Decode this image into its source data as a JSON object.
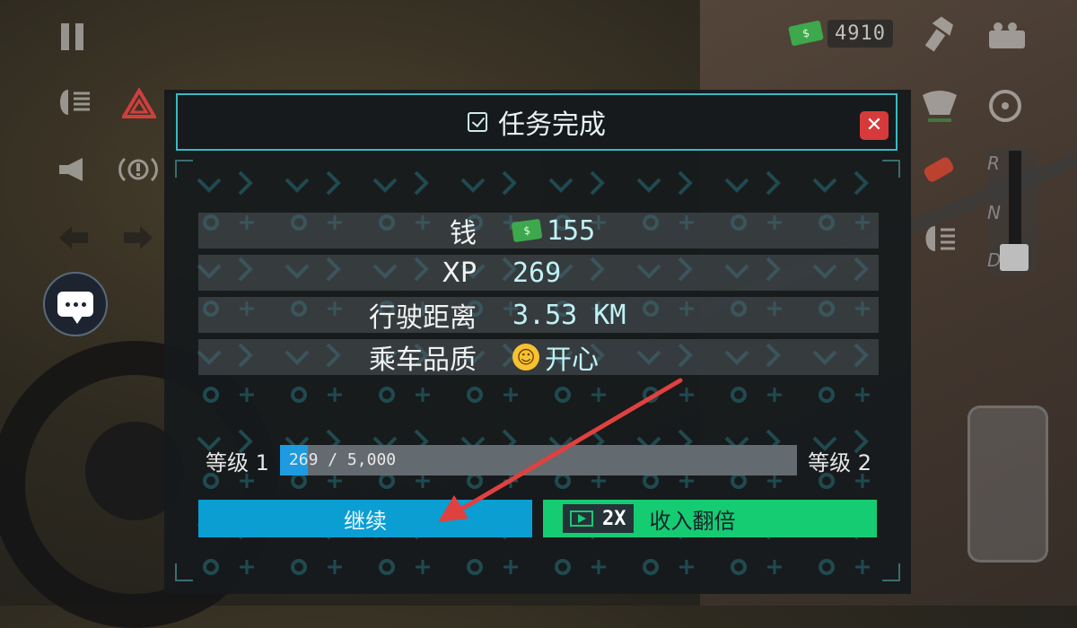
{
  "hud": {
    "money": "4910",
    "money_icon": "cash-icon",
    "pause_icon": "pause-icon"
  },
  "dialog": {
    "title": "任务完成",
    "rows": [
      {
        "label": "钱",
        "value": "155"
      },
      {
        "label": "XP",
        "value": "269"
      },
      {
        "label": "行驶距离",
        "value": "3.53 KM"
      },
      {
        "label": "乘车品质",
        "value": "开心"
      }
    ],
    "level_from": "等级 1",
    "level_to": "等级 2",
    "progress_text": "269 / 5,000",
    "progress_fraction": 0.0538,
    "continue_label": "继续",
    "double_tag": "2X",
    "double_label": "收入翻倍"
  },
  "colors": {
    "accent": "#3bb9c4",
    "continue": "#0a9ed3",
    "double": "#15cc72",
    "close": "#d63a3a",
    "annotation_arrow": "#e0413f"
  }
}
